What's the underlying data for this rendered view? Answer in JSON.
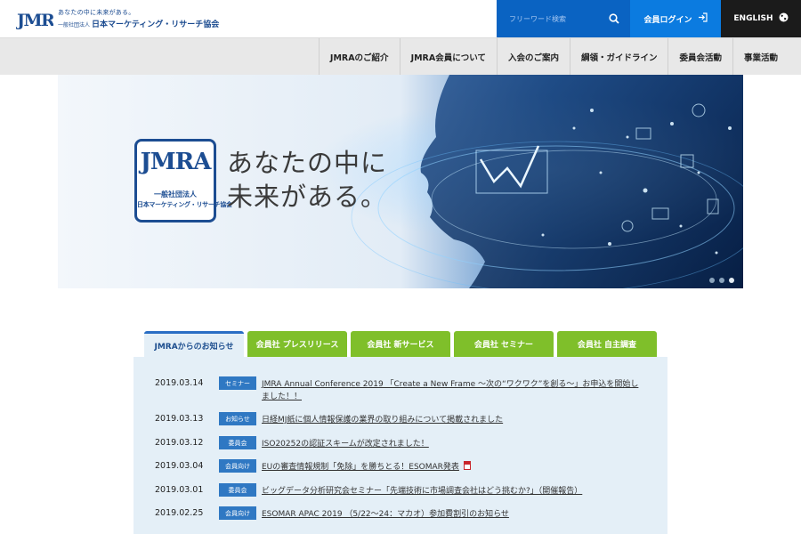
{
  "header": {
    "logo_mark": "JMRA",
    "logo_tagline": "あなたの中に未来がある。",
    "logo_org_prefix": "一般社団法人",
    "logo_org_name": "日本マーケティング・リサーチ協会",
    "search_placeholder": "フリーワード検索",
    "login_label": "会員ログイン",
    "english_label": "ENGLISH"
  },
  "nav": {
    "items": [
      "JMRAのご紹介",
      "JMRA会員について",
      "入会のご案内",
      "綱領・ガイドライン",
      "委員会活動",
      "事業活動"
    ]
  },
  "hero": {
    "logo_mark": "JMRA",
    "logo_org_line1": "一般社団法人",
    "logo_org_line2": "日本マーケティング・リサーチ協会",
    "copy_line1": "あなたの中に",
    "copy_line2": "未来がある。",
    "slide_count": 3,
    "active_slide": 3
  },
  "tabs": [
    {
      "label": "JMRAからのお知らせ",
      "active": true
    },
    {
      "label": "会員社 プレスリリース",
      "active": false
    },
    {
      "label": "会員社 新サービス",
      "active": false
    },
    {
      "label": "会員社 セミナー",
      "active": false
    },
    {
      "label": "会員社 自主調査",
      "active": false
    }
  ],
  "news": [
    {
      "date": "2019.03.14",
      "badge": "セミナー",
      "title": "JMRA Annual Conference 2019 「Create a New Frame ～次の“ワクワク”を創る～」お申込を開始しました！！",
      "pdf": false
    },
    {
      "date": "2019.03.13",
      "badge": "お知らせ",
      "title": "日経MJ紙に個人情報保護の業界の取り組みについて掲載されました",
      "pdf": false
    },
    {
      "date": "2019.03.12",
      "badge": "委員会",
      "title": "ISO20252の認証スキームが改定されました！",
      "pdf": false
    },
    {
      "date": "2019.03.04",
      "badge": "会員向け",
      "title": "EUの審査情報規制「免除」を勝ちとる！ESOMAR発表",
      "pdf": true
    },
    {
      "date": "2019.03.01",
      "badge": "委員会",
      "title": "ビッグデータ分析研究会セミナー「先端技術に市場調査会社はどう挑むか?」（開催報告）",
      "pdf": false
    },
    {
      "date": "2019.02.25",
      "badge": "会員向け",
      "title": "ESOMAR APAC 2019 （5/22～24：マカオ）参加費割引のお知らせ",
      "pdf": false
    }
  ],
  "colors": {
    "brand_blue": "#1c4d92",
    "search_blue": "#0a63c2",
    "login_blue": "#0b7be0",
    "tab_green": "#7fbf2a",
    "badge_blue": "#2f78c3",
    "panel_bg": "#e4eff7"
  },
  "icons": {
    "search": "search-icon",
    "login": "login-arrow-icon",
    "english": "globe-icon",
    "pdf": "pdf-icon"
  }
}
